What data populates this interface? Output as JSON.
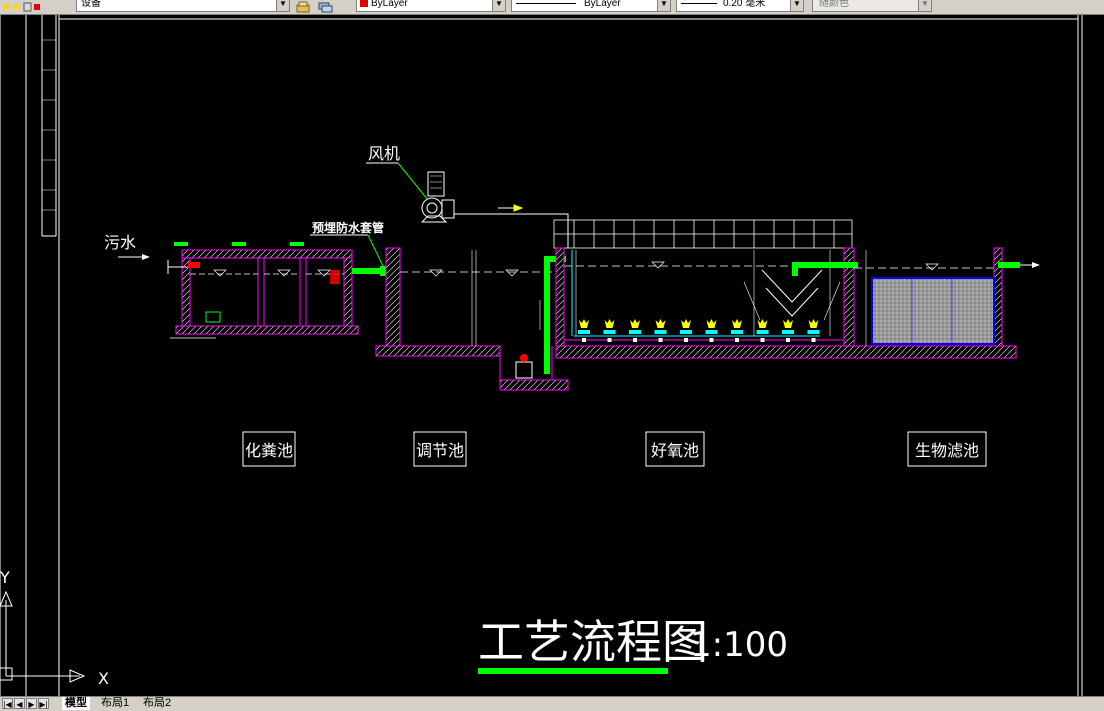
{
  "toolbar": {
    "layer_value": "设备",
    "color_value": "ByLayer",
    "linetype_value": "ByLayer",
    "lineweight_value": "0.20 毫米",
    "plotstyle_value": "随颜色"
  },
  "drawing": {
    "labels": {
      "sewage_inflow": "污水",
      "blower": "风机",
      "embedded_sleeve": "预埋防水套管"
    },
    "tanks": [
      "化粪池",
      "调节池",
      "好氧池",
      "生物滤池"
    ],
    "title": "工艺流程图",
    "scale": "1:100"
  },
  "ucs": {
    "y_label": "Y",
    "x_label": "X"
  },
  "tabs": {
    "model": "模型",
    "layout1": "布局1",
    "layout2": "布局2"
  },
  "colors": {
    "background": "#000000",
    "line": "#ffffff",
    "wall_hatch": "#ff00ff",
    "pipe": "#00ff00",
    "air_diffuser": "#ffff00",
    "filter_media": "#808080",
    "filter_outline": "#0000ff"
  }
}
